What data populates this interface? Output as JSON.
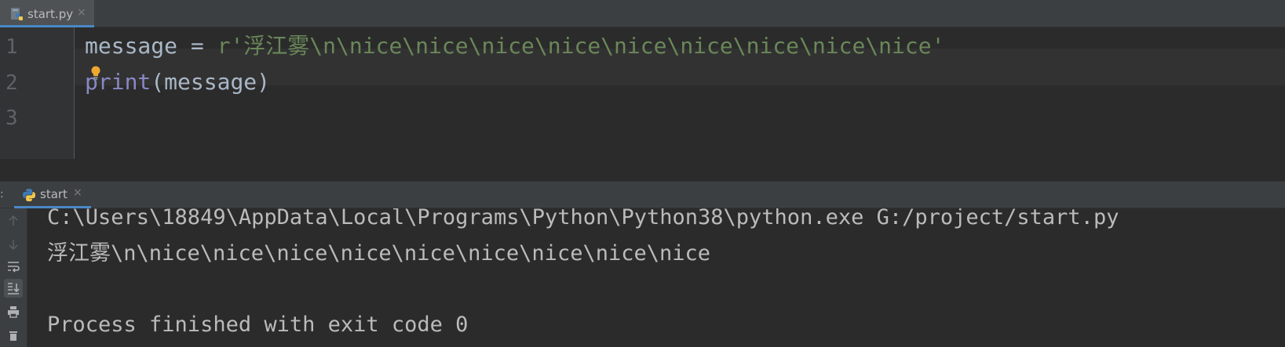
{
  "editor_tab": {
    "filename": "start.py",
    "icon": "python-file-icon",
    "close": "×"
  },
  "editor": {
    "line_numbers": [
      "1",
      "2",
      "3"
    ],
    "lines": [
      {
        "var": "message",
        "op": " = ",
        "string": "r'浮江雾\\n\\nice\\nice\\nice\\nice\\nice\\nice\\nice\\nice\\nice'"
      },
      {
        "builtin": "print",
        "args": "(message)"
      }
    ],
    "intention_icon": "lightbulb-icon"
  },
  "run_panel": {
    "more": ":",
    "tab_label": "start",
    "tab_icon": "python-icon",
    "close": "×",
    "side_icons": [
      "up-arrow-icon",
      "down-arrow-icon",
      "soft-wrap-icon",
      "scroll-to-end-icon",
      "print-icon"
    ],
    "console": [
      "C:\\Users\\18849\\AppData\\Local\\Programs\\Python\\Python38\\python.exe G:/project/start.py",
      "浮江雾\\n\\nice\\nice\\nice\\nice\\nice\\nice\\nice\\nice\\nice",
      "",
      "Process finished with exit code 0"
    ]
  },
  "colors": {
    "background": "#2b2b2b",
    "string": "#6a8759",
    "builtin": "#8888c6",
    "text": "#a9b7c6",
    "accent": "#4a88c7"
  }
}
